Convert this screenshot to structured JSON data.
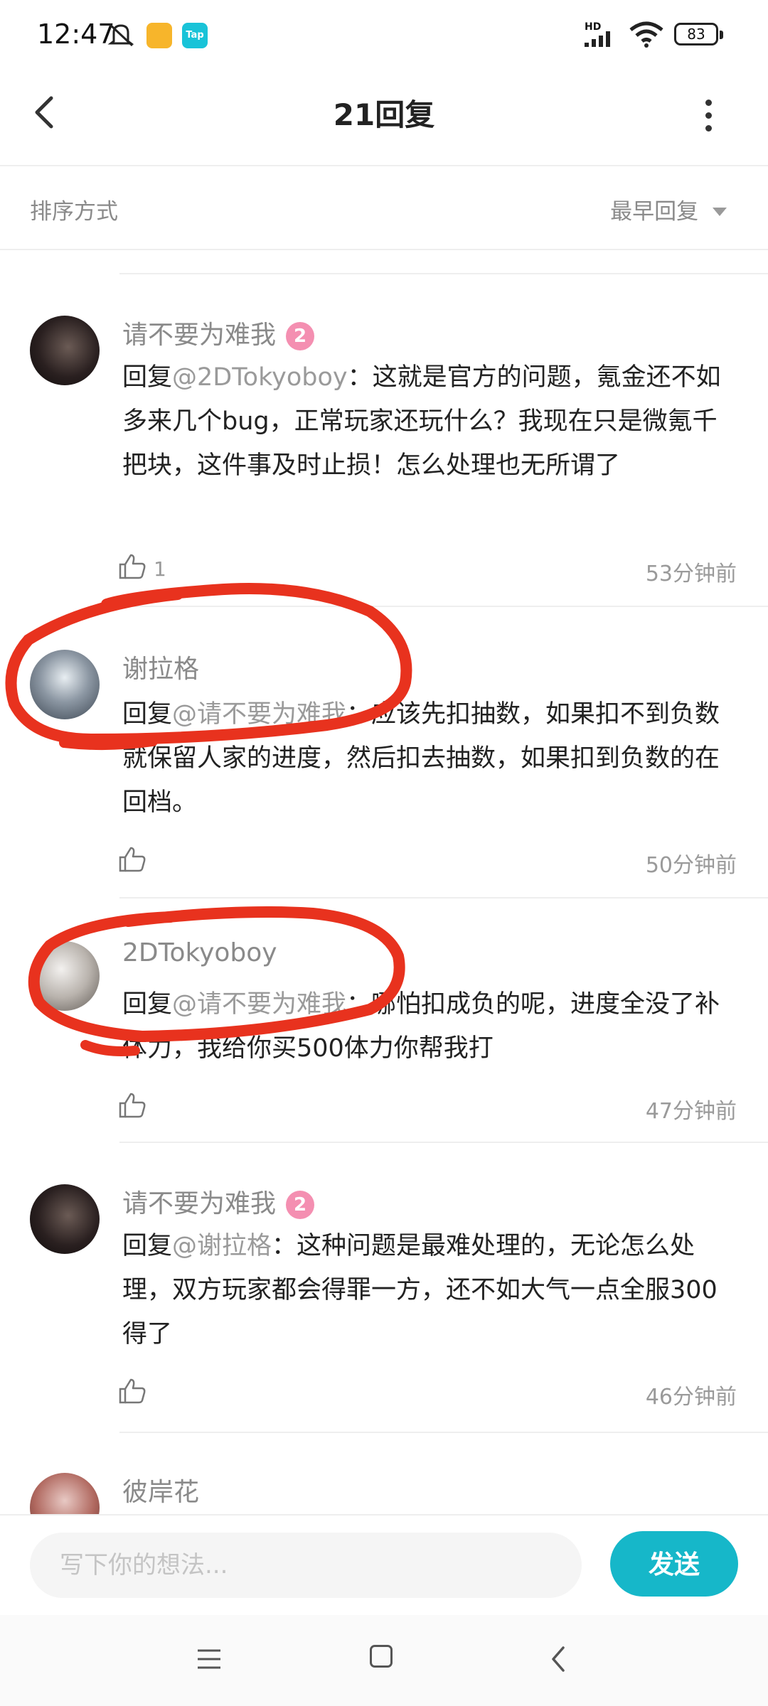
{
  "status_bar": {
    "time": "12:47",
    "network": "HD",
    "battery": "83",
    "app_badge_tap": "Tap"
  },
  "header": {
    "title": "21回复"
  },
  "sort": {
    "label": "排序方式",
    "value": "最早回复"
  },
  "replies": [
    {
      "username": "请不要为难我",
      "level": "2",
      "prefix": "回复",
      "mention": "@2DTokyoboy",
      "text": "：这就是官方的问题，氪金还不如多来几个bug，正常玩家还玩什么？我现在只是微氪千把块，这件事及时止损！怎么处理也无所谓了",
      "likes": "1",
      "time": "53分钟前"
    },
    {
      "username": "谢拉格",
      "prefix": "回复",
      "mention": "@请不要为难我",
      "text": "：应该先扣抽数，如果扣不到负数就保留人家的进度，然后扣去抽数，如果扣到负数的在回档。",
      "time": "50分钟前"
    },
    {
      "username": "2DTokyoboy",
      "prefix": "回复",
      "mention": "@请不要为难我",
      "text": "：哪怕扣成负的呢，进度全没了补体力，我给你买500体力你帮我打",
      "time": "47分钟前"
    },
    {
      "username": "请不要为难我",
      "level": "2",
      "prefix": "回复",
      "mention": "@谢拉格",
      "text": "：这种问题是最难处理的，无论怎么处理，双方玩家都会得罪一方，还不如大气一点全服300得了",
      "time": "46分钟前"
    },
    {
      "username": "彼岸花"
    }
  ],
  "input": {
    "placeholder": "写下你的想法...",
    "send_label": "发送"
  },
  "colors": {
    "accent": "#16b7c9",
    "level_badge": "#f48fb1",
    "annotation": "#e8321e"
  }
}
